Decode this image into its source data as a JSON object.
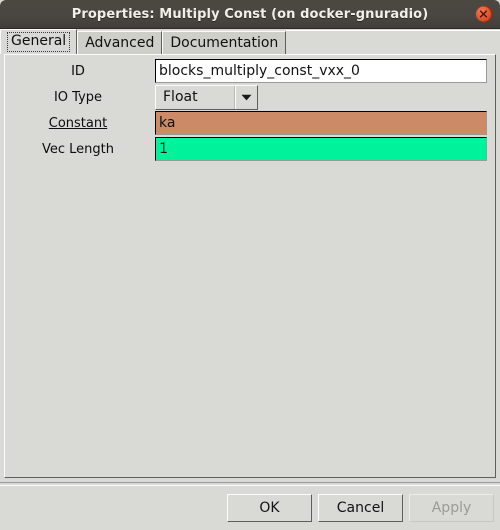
{
  "window": {
    "title": "Properties: Multiply Const (on docker-gnuradio)",
    "close_icon": "close-icon",
    "accent_titlebar": "#4a4742",
    "background": "#d9d9d5"
  },
  "tabs": [
    {
      "label": "General",
      "active": true
    },
    {
      "label": "Advanced",
      "active": false
    },
    {
      "label": "Documentation",
      "active": false
    }
  ],
  "form": {
    "rows": [
      {
        "label": "ID",
        "type": "text",
        "value": "blocks_multiply_const_vxx_0",
        "placeholder": "",
        "field_color": "#ffffff",
        "flagged": false
      },
      {
        "label": "IO Type",
        "type": "combo",
        "value": "Float",
        "arrow_icon": "chevron-down-icon",
        "flagged": false
      },
      {
        "label": "Constant",
        "type": "text",
        "value": "ka",
        "placeholder": "",
        "field_color": "#cd8a66",
        "flagged": true
      },
      {
        "label": "Vec Length",
        "type": "text",
        "value": "1",
        "placeholder": "",
        "field_color": "#00f29a",
        "flagged": false
      }
    ]
  },
  "actions": {
    "ok_label": "OK",
    "cancel_label": "Cancel",
    "apply_label": "Apply",
    "apply_disabled": true
  }
}
